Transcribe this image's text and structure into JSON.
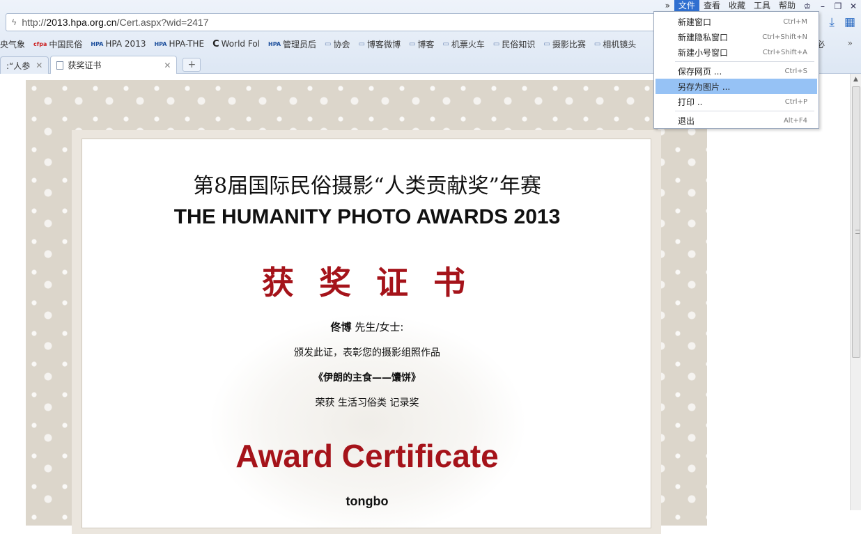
{
  "topbar": {
    "more": "»",
    "menus": [
      "文件",
      "查看",
      "收藏",
      "工具",
      "帮助"
    ],
    "active_menu": "文件",
    "icons": [
      "shirt-icon",
      "minimize-icon",
      "restore-icon",
      "close-icon"
    ]
  },
  "address": {
    "prefix": "http://",
    "domain": "2013.hpa.org.cn",
    "path": "/Cert.aspx?wid=2417"
  },
  "bookmarks": [
    {
      "label": "央气象",
      "icon": ""
    },
    {
      "label": "中国民俗",
      "icon": "cfpa"
    },
    {
      "label": "HPA 2013",
      "icon": "HPA"
    },
    {
      "label": "HPA-THE",
      "icon": "HPA"
    },
    {
      "label": "World Fol",
      "icon": "C"
    },
    {
      "label": "管理员后",
      "icon": "HPA"
    },
    {
      "label": "协会",
      "icon": "folder"
    },
    {
      "label": "博客微博",
      "icon": "folder"
    },
    {
      "label": "博客",
      "icon": "folder"
    },
    {
      "label": "机票火车",
      "icon": "folder"
    },
    {
      "label": "民俗知识",
      "icon": "folder"
    },
    {
      "label": "摄影比赛",
      "icon": "folder"
    },
    {
      "label": "相机镜头",
      "icon": "folder"
    }
  ],
  "bookmarks_extra": "必",
  "bookmarks_more": "»",
  "tabs": [
    {
      "label": ":“人参",
      "active": false
    },
    {
      "label": "获奖证书",
      "active": true
    }
  ],
  "new_tab": "+",
  "file_menu": [
    {
      "label": "新建窗口",
      "shortcut": "Ctrl+M"
    },
    {
      "label": "新建隐私窗口",
      "shortcut": "Ctrl+Shift+N"
    },
    {
      "label": "新建小号窗口",
      "shortcut": "Ctrl+Shift+A"
    },
    {
      "label": "保存网页 ...",
      "shortcut": "Ctrl+S"
    },
    {
      "label": "另存为图片 ...",
      "shortcut": ""
    },
    {
      "label": "打印 ..",
      "shortcut": "Ctrl+P"
    },
    {
      "label": "退出",
      "shortcut": "Alt+F4"
    }
  ],
  "highlighted_menu_item": "另存为图片 ...",
  "certificate": {
    "title_cn": "第8届国际民俗摄影“人类贡献奖”年赛",
    "title_en": "THE HUMANITY PHOTO AWARDS 2013",
    "heading_cn": "获 奖 证 书",
    "recipient_name": "佟博",
    "recipient_suffix": "先生/女士:",
    "line1": "颁发此证，表彰您的摄影组照作品",
    "work_title": "《伊朗的主食——馕饼》",
    "award_line": "荣获  生活习俗类  记录奖",
    "heading_en": "Award Certificate",
    "recipient_en": "tongbo"
  },
  "colors": {
    "accent_red": "#a5131a",
    "menu_highlight": "#96c2f5",
    "active_menu": "#2f6fd0"
  }
}
